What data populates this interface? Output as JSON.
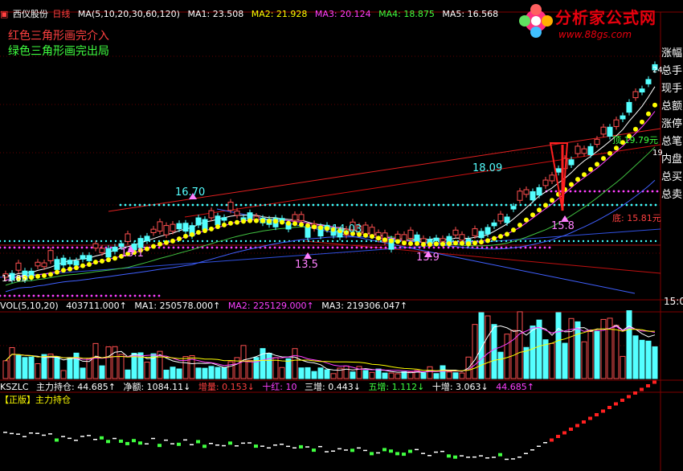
{
  "price_header": {
    "stock": "西仪股份",
    "period": "日线",
    "ma_label": "MA(5,10,20,30,60,120)",
    "ma1": "MA1: 23.508",
    "ma2": "MA2: 21.928",
    "ma3": "MA3: 20.124",
    "ma4": "MA4: 18.875",
    "ma5": "MA5: 16.568"
  },
  "annotations": {
    "buy_note": "红色三角形画完介入",
    "sell_note": "绿色三角形画完出局"
  },
  "price_labels": {
    "p1670": "16.70",
    "p1809": "18.09",
    "p1403": "14.03",
    "p1151": "15.1",
    "p135": "13.5",
    "p139": "13.9",
    "p158": "15.8",
    "p1185": "11.85",
    "top1979": "顶 19.79元",
    "bot1581": "底: 15.81元"
  },
  "right_panel": [
    "涨幅",
    "总手",
    "现手",
    "总额",
    "涨停",
    "总笔",
    "内盘",
    "总买",
    "总卖"
  ],
  "right_values": {
    "v1": "24",
    "v2": "19"
  },
  "time_label": "15:0",
  "vol_header": {
    "label": "VOL(5,10,20)",
    "vol": "403711.000↑",
    "ma1": "MA1: 250578.000↑",
    "ma2": "MA2: 225129.000↑",
    "ma3": "MA3: 219306.047↑"
  },
  "kszlc_header": {
    "label": "KSZLC",
    "a": "主力持仓: 44.685↑",
    "b": "净额: 1084.11↓",
    "c": "增量: 0.153↓",
    "d": "十红: 10",
    "e": "三增: 0.443↓",
    "f": "五增: 1.112↓",
    "g": "十增: 3.063↓",
    "h": "44.685↑"
  },
  "kszlc_sub": "【正版】主力持仓",
  "watermark": {
    "title": "分析家公式网",
    "url": "www.88gs.com"
  },
  "colors": {
    "up": "#ff5050",
    "down": "#54ffff",
    "ma_yellow": "#ffff00",
    "ma_magenta": "#ff40ff",
    "ma_green": "#40c040"
  }
}
